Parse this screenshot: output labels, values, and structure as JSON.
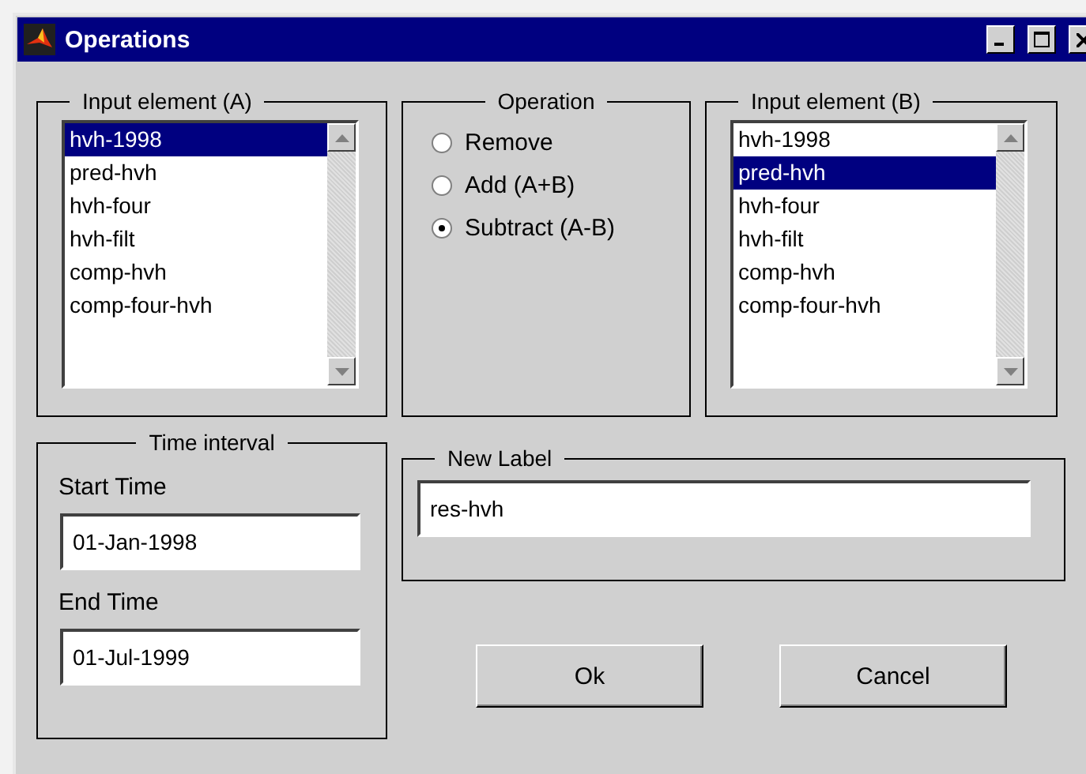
{
  "window": {
    "title": "Operations"
  },
  "input_a": {
    "title": "Input element (A)",
    "items": [
      {
        "label": "hvh-1998",
        "selected": true
      },
      {
        "label": "pred-hvh",
        "selected": false
      },
      {
        "label": "hvh-four",
        "selected": false
      },
      {
        "label": "hvh-filt",
        "selected": false
      },
      {
        "label": "comp-hvh",
        "selected": false
      },
      {
        "label": "comp-four-hvh",
        "selected": false
      }
    ]
  },
  "operation": {
    "title": "Operation",
    "options": [
      {
        "label": "Remove",
        "selected": false
      },
      {
        "label": "Add (A+B)",
        "selected": false
      },
      {
        "label": "Subtract (A-B)",
        "selected": true
      }
    ]
  },
  "input_b": {
    "title": "Input element (B)",
    "items": [
      {
        "label": "hvh-1998",
        "selected": false
      },
      {
        "label": "pred-hvh",
        "selected": true
      },
      {
        "label": "hvh-four",
        "selected": false
      },
      {
        "label": "hvh-filt",
        "selected": false
      },
      {
        "label": "comp-hvh",
        "selected": false
      },
      {
        "label": "comp-four-hvh",
        "selected": false
      }
    ]
  },
  "time_interval": {
    "title": "Time interval",
    "fields": [
      {
        "label": "Start Time",
        "value": "01-Jan-1998"
      },
      {
        "label": "End Time",
        "value": "01-Jul-1999"
      }
    ]
  },
  "new_label": {
    "title": "New Label",
    "value": "res-hvh"
  },
  "buttons": [
    "Ok",
    "Cancel"
  ]
}
